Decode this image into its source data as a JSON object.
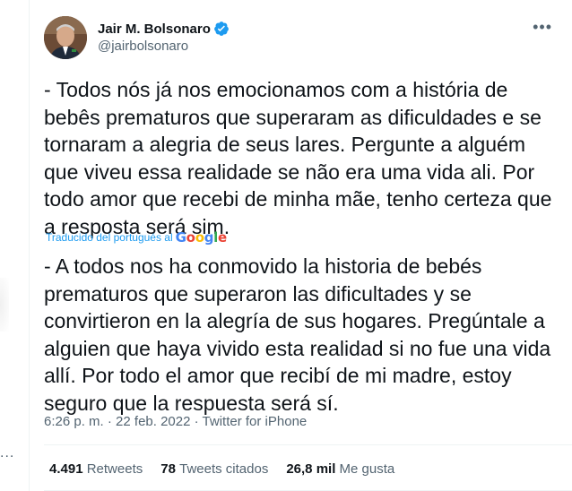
{
  "author": {
    "name": "Jair M. Bolsonaro",
    "handle": "@jairbolsonaro",
    "verified": true
  },
  "more_icon": "•••",
  "tweet_text_original": "- Todos nós já nos emocionamos com a história de\nbebês prematuros que superaram as dificuldades e se\ntornaram a alegria de seus lares. Pergunte a alguém\nque viveu essa realidade se não era uma vida ali. Por\ntodo amor que recebi de minha mãe, tenho certeza que\na resposta será sim.",
  "translation_label": "Traducido del portugués al",
  "translation_provider": "Google",
  "tweet_text_translated": "- A todos nos ha conmovido la historia de bebés\nprematuros que superaron las dificultades y se\nconvirtieron en la alegría de sus hogares. Pregúntale a\nalguien que haya vivido esta realidad si no fue una vida\nallí. Por todo el amor que recibí de mi madre, estoy\nseguro que la respuesta será sí.",
  "meta": {
    "time": "6:26 p. m.",
    "separator": "·",
    "date": "22 feb. 2022",
    "source": "Twitter for iPhone"
  },
  "stats": {
    "retweets_count": "4.491",
    "retweets_label": "Retweets",
    "quotes_count": "78",
    "quotes_label": "Tweets citados",
    "likes_count": "26,8 mil",
    "likes_label": "Me gusta"
  },
  "left_menu_dots": "...",
  "colors": {
    "accent": "#1d9bf0",
    "secondary_text": "#536471",
    "primary_text": "#0f1419"
  }
}
